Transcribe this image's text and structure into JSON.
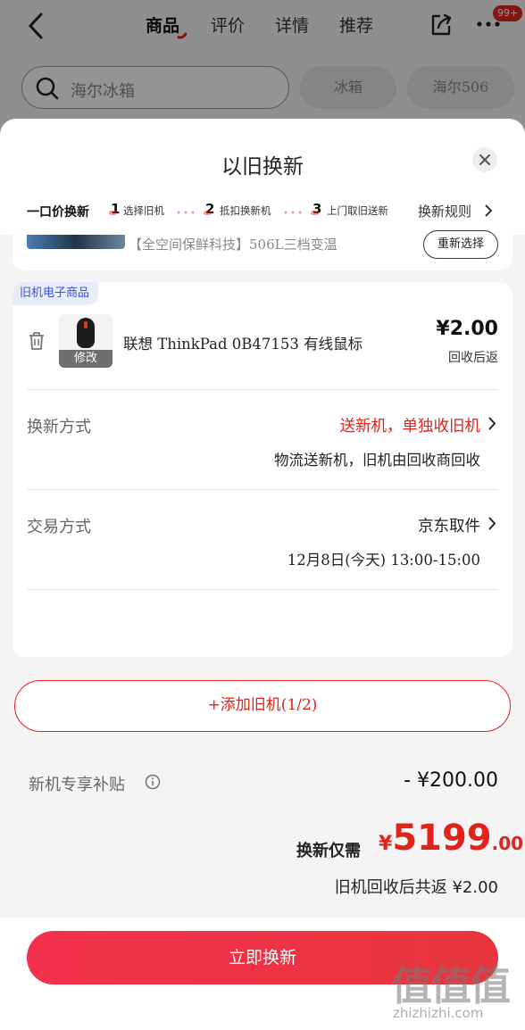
{
  "nav": {
    "tabs": [
      "商品",
      "评价",
      "详情",
      "推荐"
    ],
    "active_tab": "商品",
    "badge": "99+"
  },
  "search": {
    "value": "海尔冰箱",
    "chips": [
      "冰箱",
      "海尔506"
    ]
  },
  "sheet": {
    "title": "以旧换新",
    "steps": {
      "main": "一口价换新",
      "items": [
        {
          "num": "1",
          "label": "选择旧机"
        },
        {
          "num": "2",
          "label": "抵扣换新机"
        },
        {
          "num": "3",
          "label": "上门取旧送新"
        }
      ],
      "rules_link": "换新规则"
    },
    "new_product": {
      "description": "【全空间保鲜科技】506L三档变温",
      "reselect_label": "重新选择"
    },
    "old_device": {
      "tag": "旧机电子商品",
      "edit_label": "修改",
      "name": "联想 ThinkPad 0B47153 有线鼠标",
      "price": "¥2.00",
      "price_note": "回收后返",
      "exchange_method": {
        "label": "换新方式",
        "value": "送新机，单独收旧机",
        "sub": "物流送新机，旧机由回收商回收"
      },
      "trade_method": {
        "label": "交易方式",
        "value": "京东取件",
        "sub": "12月8日(今天) 13:00-15:00"
      }
    },
    "add_button": "+添加旧机(1/2)",
    "subsidy": {
      "label": "新机专享补贴",
      "value": "- ¥200.00"
    },
    "total": {
      "label": "换新仅需",
      "currency": "¥",
      "integer": "5199",
      "decimal": ".00"
    },
    "return_note": "旧机回收后共返 ¥2.00",
    "confirm_button": "立即换新"
  },
  "watermark": {
    "logo": "值值值",
    "site": "zhizhizhi.com"
  },
  "colors": {
    "brand_red": "#e2231a",
    "tag_blue": "#3b55c6"
  }
}
